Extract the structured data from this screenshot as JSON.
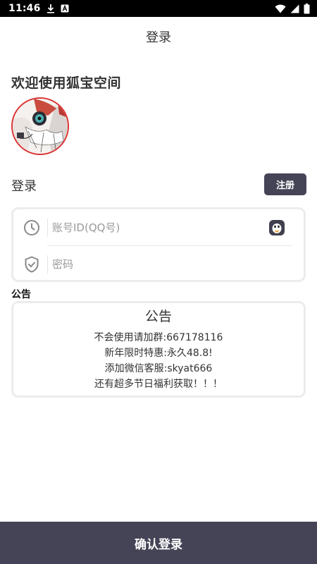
{
  "status_bar": {
    "time": "11:46",
    "icons": [
      "download-icon",
      "notification-a-icon",
      "wifi-icon",
      "signal-icon",
      "battery-icon"
    ]
  },
  "header": {
    "title": "登录"
  },
  "welcome_text": "欢迎使用狐宝空间",
  "login_section": {
    "label": "登录",
    "register_label": "注册"
  },
  "form": {
    "account_placeholder": "账号ID(QQ号)",
    "account_value": "",
    "password_placeholder": "密码",
    "password_value": ""
  },
  "notice": {
    "section_label": "公告",
    "title": "公告",
    "lines": [
      "不会使用请加群:667178116",
      "新年限时特惠:永久48.8!",
      "添加微信客服:skyat666",
      "还有超多节日福利获取！！！"
    ]
  },
  "confirm_label": "确认登录",
  "colors": {
    "primary_button": "#454456",
    "card_border": "#ececec",
    "status_bar": "#000000"
  }
}
